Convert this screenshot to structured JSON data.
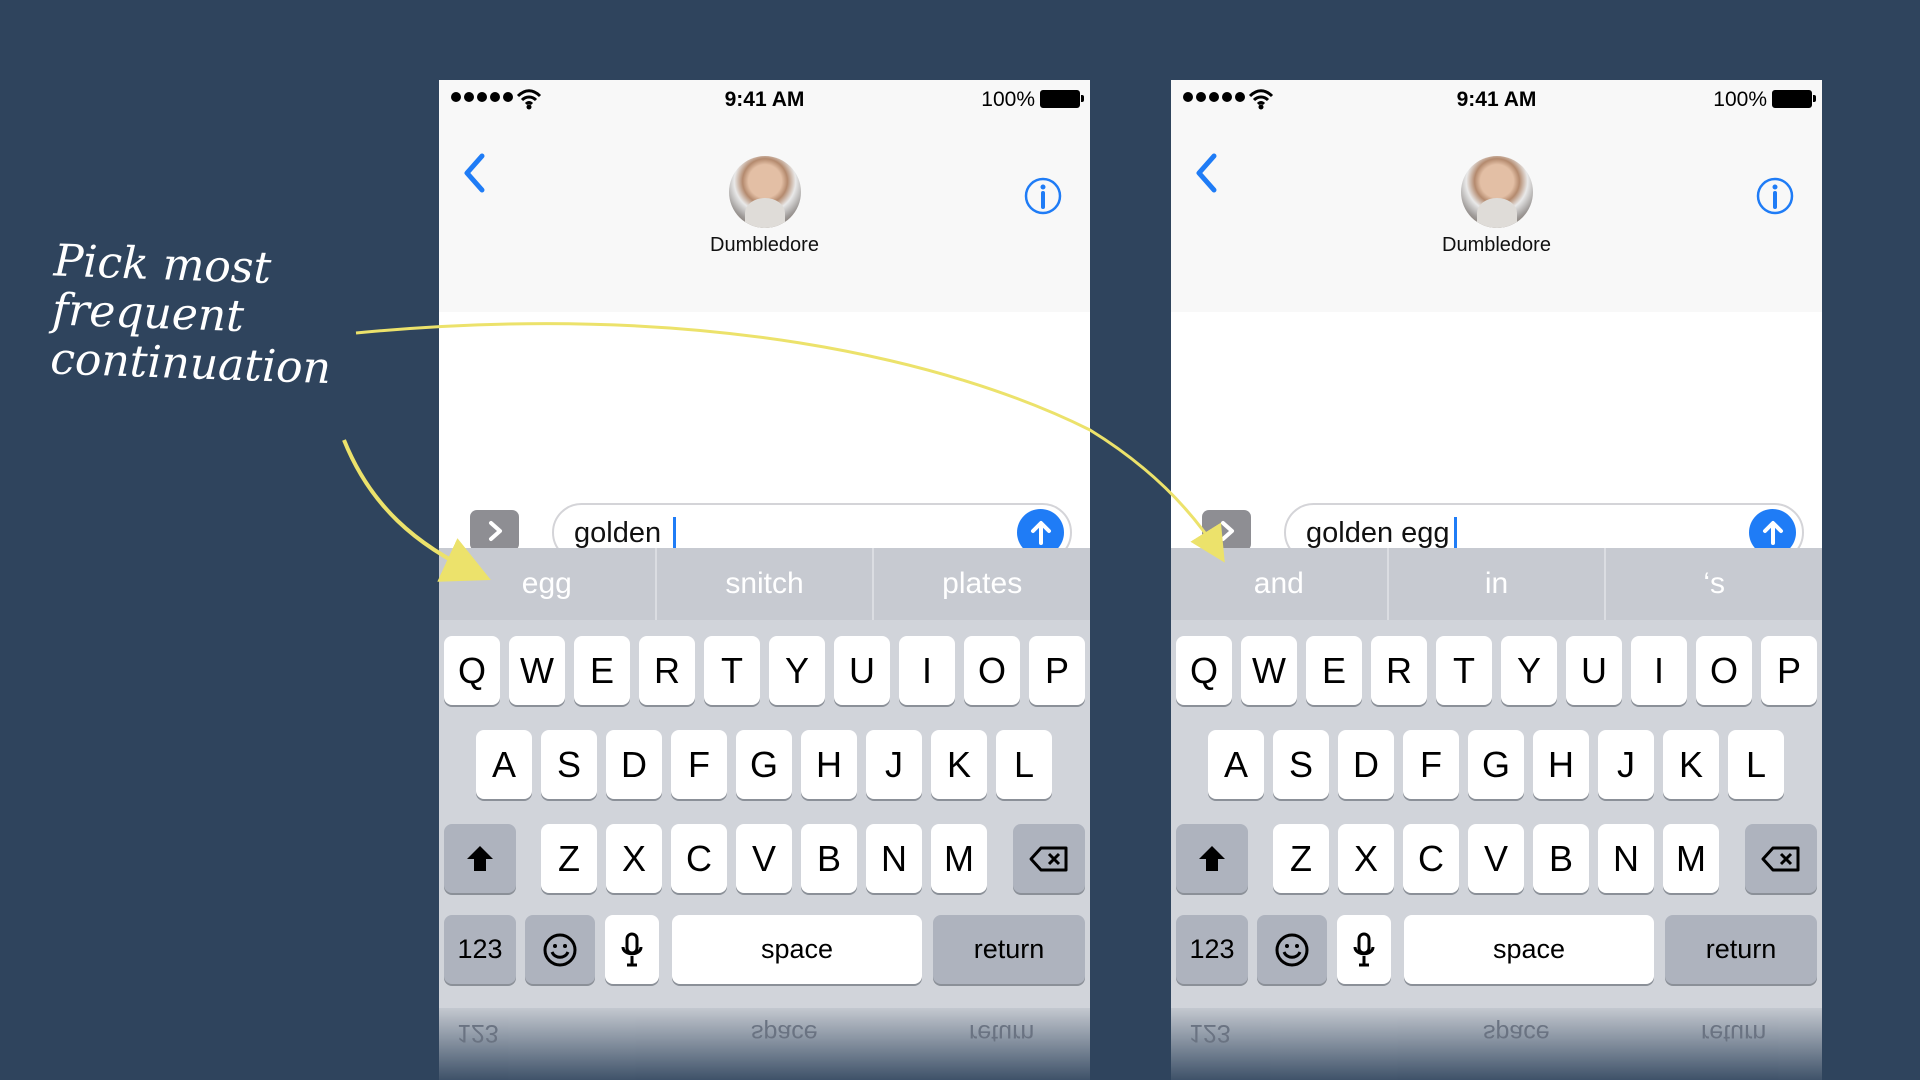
{
  "annotation": {
    "lines": [
      "Pick most",
      "frequent",
      "continuation"
    ],
    "arrow_color": "#ece26b"
  },
  "phones": [
    {
      "status": {
        "time": "9:41 AM",
        "battery": "100%"
      },
      "contact": {
        "name": "Dumbledore"
      },
      "input": {
        "text": "golden "
      },
      "predictions": [
        "egg",
        "snitch",
        "plates"
      ],
      "keys": {
        "row1": [
          "Q",
          "W",
          "E",
          "R",
          "T",
          "Y",
          "U",
          "I",
          "O",
          "P"
        ],
        "row2": [
          "A",
          "S",
          "D",
          "F",
          "G",
          "H",
          "J",
          "K",
          "L"
        ],
        "row3": [
          "Z",
          "X",
          "C",
          "V",
          "B",
          "N",
          "M"
        ],
        "bottom": {
          "numbers": "123",
          "space": "space",
          "return": "return"
        }
      }
    },
    {
      "status": {
        "time": "9:41 AM",
        "battery": "100%"
      },
      "contact": {
        "name": "Dumbledore"
      },
      "input": {
        "text": "golden egg"
      },
      "predictions": [
        "and",
        "in",
        "‘s"
      ],
      "keys": {
        "row1": [
          "Q",
          "W",
          "E",
          "R",
          "T",
          "Y",
          "U",
          "I",
          "O",
          "P"
        ],
        "row2": [
          "A",
          "S",
          "D",
          "F",
          "G",
          "H",
          "J",
          "K",
          "L"
        ],
        "row3": [
          "Z",
          "X",
          "C",
          "V",
          "B",
          "N",
          "M"
        ],
        "bottom": {
          "numbers": "123",
          "space": "space",
          "return": "return"
        }
      }
    }
  ],
  "colors": {
    "accent": "#1f7cf6",
    "background": "#2f445d"
  }
}
